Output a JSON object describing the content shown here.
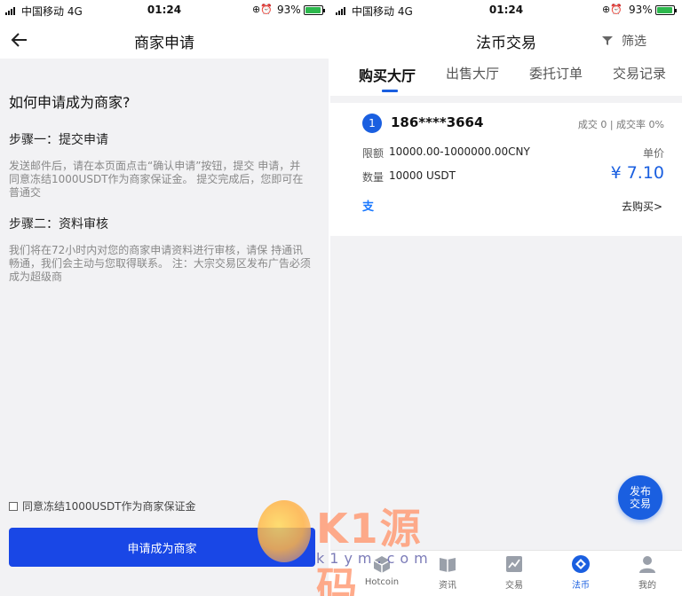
{
  "status_bar": {
    "carrier": "中国移动 4G",
    "time": "01:24",
    "battery": "93%"
  },
  "left_screen": {
    "nav_title": "商家申请",
    "question": "如何申请成为商家?",
    "steps": [
      {
        "title": "步骤一：提交申请",
        "text": "发送邮件后，请在本页面点击“确认申请”按钮，提交 申请，并同意冻结1000USDT作为商家保证金。 提交完成后，您即可在普通交"
      },
      {
        "title": "步骤二：资料审核",
        "text": "我们将在72小时内对您的商家申请资料进行审核，请保 持通讯畅通，我们会主动与您取得联系。 注：大宗交易区发布广告必须成为超级商"
      }
    ],
    "agree_text": "同意冻结1000USDT作为商家保证金",
    "apply_button": "申请成为商家"
  },
  "right_screen": {
    "nav_title": "法币交易",
    "filter_label": "筛选",
    "tabs": [
      "购买大厅",
      "出售大厅",
      "委托订单",
      "交易记录"
    ],
    "active_tab": 0,
    "listing": {
      "rank": "1",
      "user": "186****3664",
      "stats": "成交 0 | 成交率 0%",
      "limit_label": "限额",
      "limit_value": "10000.00-1000000.00CNY",
      "qty_label": "数量",
      "qty_value": "10000 USDT",
      "unit_label": "单价",
      "price": "¥ 7.10",
      "pay_icon": "支",
      "buy_link": "去购买>"
    },
    "publish_button": "发布\n交易",
    "bottom_nav": [
      {
        "label": "Hotcoin",
        "icon": "cube-icon"
      },
      {
        "label": "资讯",
        "icon": "book-icon"
      },
      {
        "label": "交易",
        "icon": "chart-icon"
      },
      {
        "label": "法币",
        "icon": "fiat-icon"
      },
      {
        "label": "我的",
        "icon": "person-icon"
      }
    ],
    "active_nav": 3
  },
  "watermark": {
    "main": "K1源码",
    "sub": "k1ym.com"
  },
  "colors": {
    "primary": "#1a5fe0",
    "apply_button": "#1947e6",
    "background": "#f2f2f4",
    "battery": "#2db84d"
  }
}
